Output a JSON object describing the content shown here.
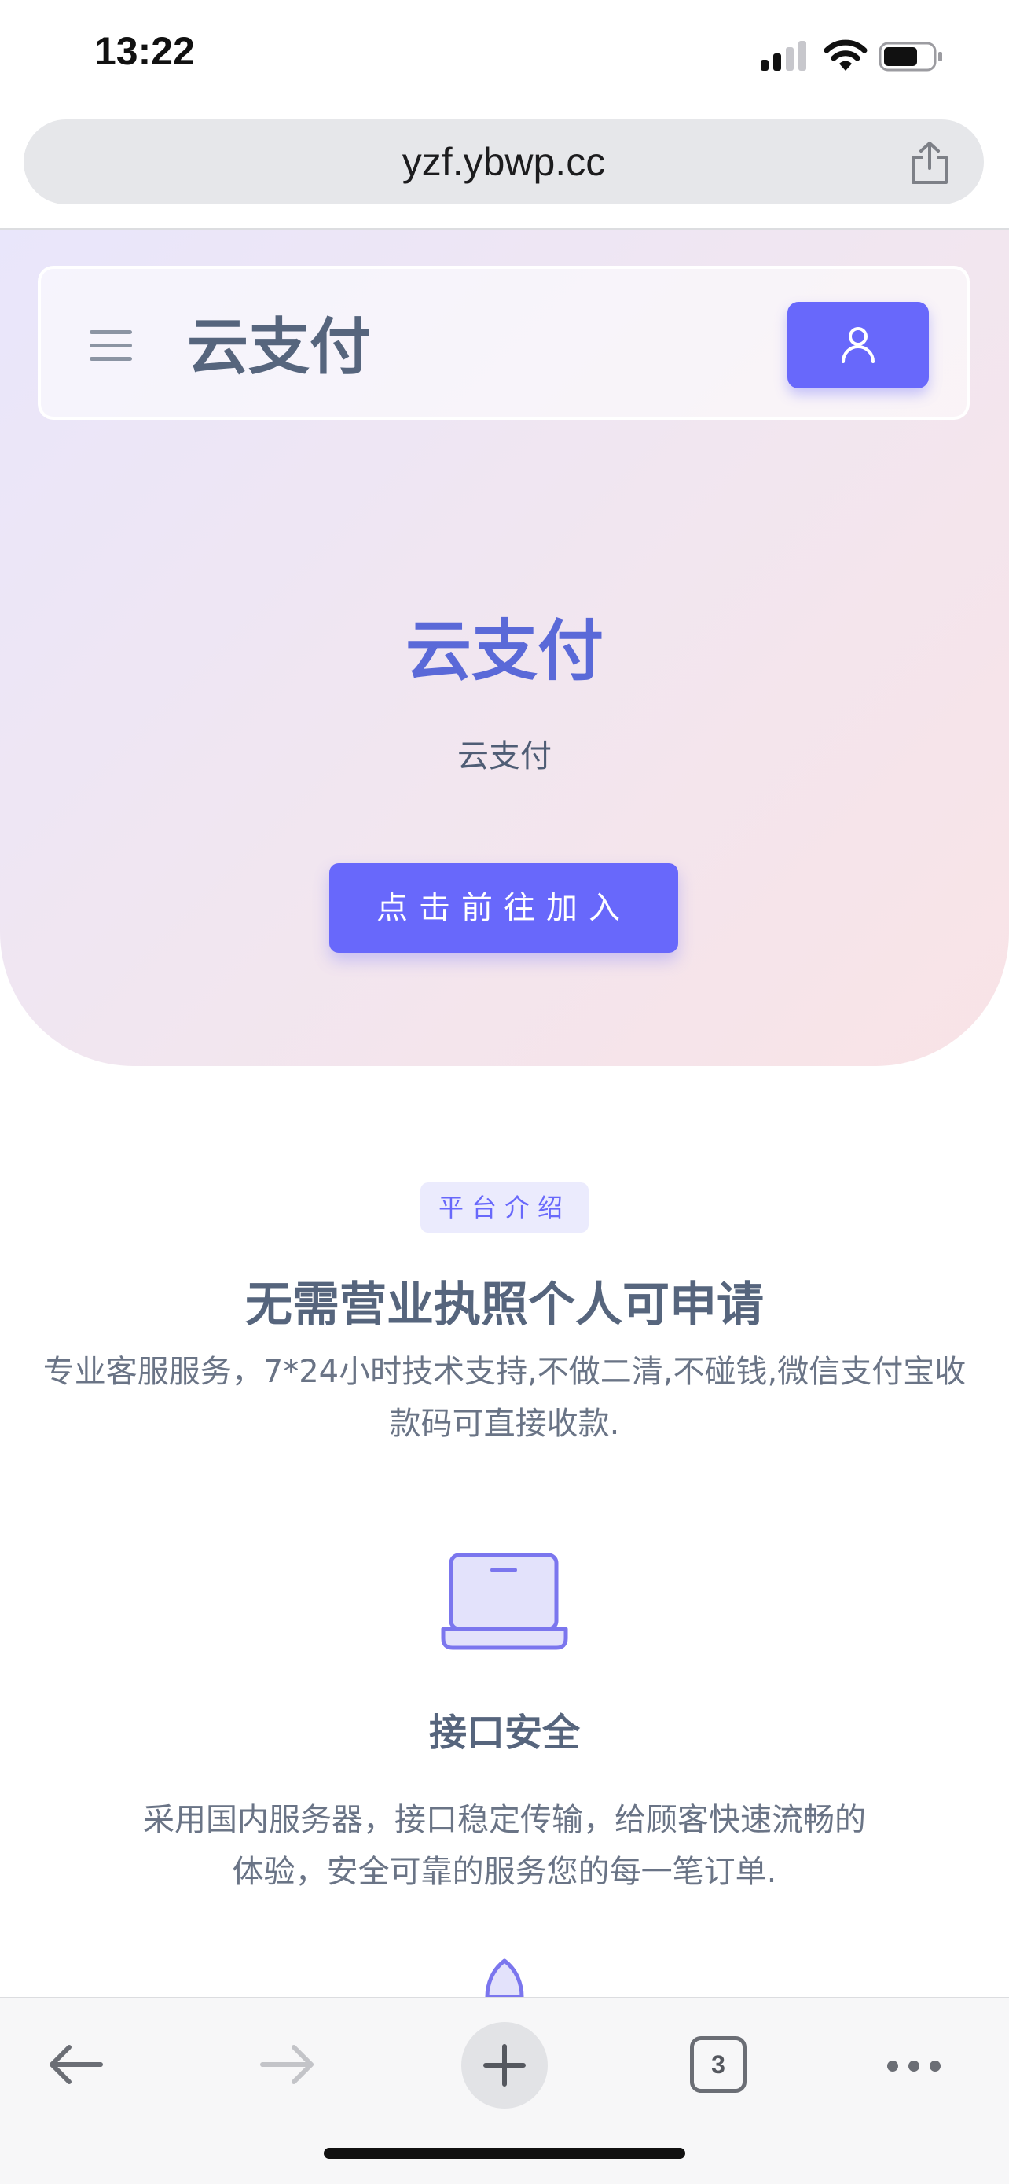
{
  "status_bar": {
    "time": "13:22"
  },
  "browser": {
    "url": "yzf.ybwp.cc",
    "tab_count": "3"
  },
  "navbar": {
    "brand": "云支付"
  },
  "hero": {
    "title": "云支付",
    "subtitle": "云支付",
    "cta_label": "点击前往加入"
  },
  "intro": {
    "badge": "平台介绍",
    "title": "无需营业执照个人可申请",
    "description": "专业客服服务，7*24小时技术支持,不做二清,不碰钱,微信支付宝收款码可直接收款."
  },
  "features": [
    {
      "icon": "laptop-icon",
      "title": "接口安全",
      "description": "采用国内服务器，接口稳定传输，给顾客快速流畅的体验，安全可靠的服务您的每一笔订单."
    }
  ],
  "colors": {
    "accent": "#6868fb",
    "hero_title": "#5a69d8",
    "text": "#56657d"
  }
}
